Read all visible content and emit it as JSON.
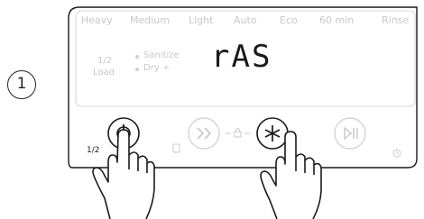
{
  "step_number": "1",
  "programs": [
    "Heavy",
    "Medium",
    "Light",
    "Auto",
    "Eco",
    "60 min",
    "Rinse"
  ],
  "half_load": {
    "line1": "1/2",
    "line2": "Load"
  },
  "options": [
    "Sanitize",
    "Dry +"
  ],
  "display_text": "rAS",
  "buttons": {
    "power_caption": "1/2",
    "power_icon": "power-icon",
    "delay_icon": "fast-forward-icon",
    "lock_icon": "lock-icon",
    "star_icon": "asterisk-icon",
    "start_icon": "play-pause-icon"
  },
  "colors": {
    "outline": "#1a1a1a",
    "faded": "#c8c8c8",
    "active": "#1a1a1a"
  }
}
